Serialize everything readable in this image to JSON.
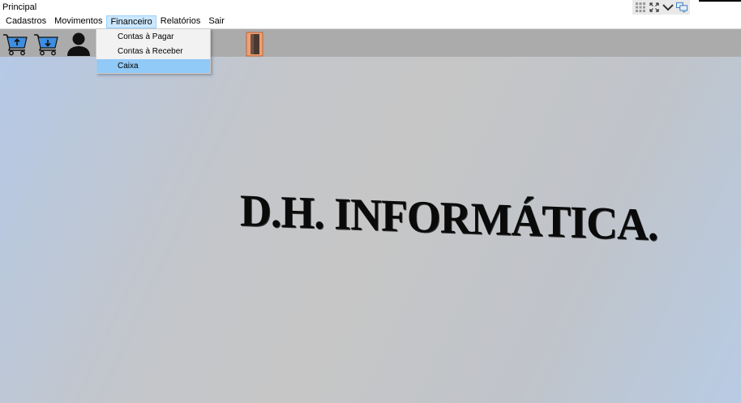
{
  "window": {
    "title": "Principal"
  },
  "title_controls": [
    {
      "icon": "grid-icon"
    },
    {
      "icon": "expand-icon"
    },
    {
      "icon": "chevron-down-icon"
    },
    {
      "icon": "monitor-icon"
    }
  ],
  "menu": {
    "items": [
      "Cadastros",
      "Movimentos",
      "Financeiro",
      "Relatórios",
      "Sair"
    ],
    "active": "Financeiro"
  },
  "dropdown": {
    "items": [
      "Contas à Pagar",
      "Contas à Receber",
      "Caixa"
    ],
    "highlighted": "Caixa"
  },
  "toolbar": {
    "buttons": [
      {
        "icon": "cart-upload-icon"
      },
      {
        "icon": "cart-download-icon"
      },
      {
        "icon": "user-icon"
      },
      {
        "icon": "exit-door-icon"
      }
    ]
  },
  "brand": {
    "text": "D.H. INFORMÁTICA."
  },
  "colors": {
    "toolbar_bg": "#ababab",
    "menu_highlight": "#cce8ff",
    "dropdown_highlight": "#91c9f7",
    "cart_blue": "#3d8ee0"
  }
}
